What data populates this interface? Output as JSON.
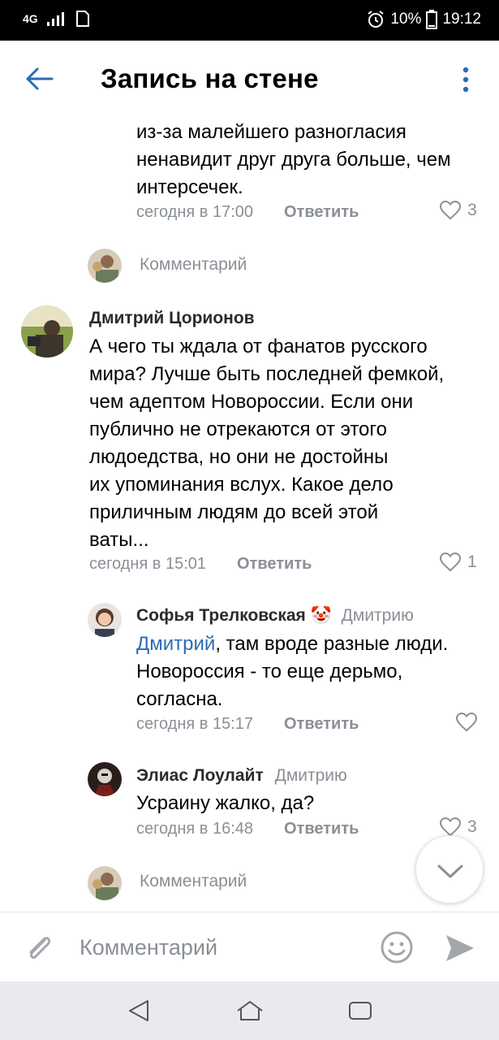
{
  "status_bar": {
    "network": "4G",
    "battery": "10%",
    "time": "19:12"
  },
  "header": {
    "title": "Запись на стене"
  },
  "comments": {
    "top_text_lines": [
      "из-за малейшего разногласия",
      "ненавидит друг друга больше, чем",
      "интерсечек."
    ],
    "top_time": "сегодня в 17:00",
    "top_reply": "Ответить",
    "top_likes": "3",
    "prompt1": "Комментарий",
    "c1_name": "Дмитрий Цорионов",
    "c1_lines": [
      "А чего ты ждала от фанатов русского",
      "мира? Лучше быть последней фемкой,",
      "чем адептом Новороссии. Если они",
      "публично не отрекаются от этого",
      "людоедства, но они не достойны",
      "их упоминания вслух. Какое дело",
      "приличным людям до всей этой",
      "ваты..."
    ],
    "c1_time": "сегодня в 15:01",
    "c1_reply": "Ответить",
    "c1_likes": "1",
    "c2_name": "Софья Трелковская",
    "c2_emoji": "🤡",
    "c2_to": "Дмитрию",
    "c2_mention": "Дмитрий",
    "c2_line1_rest": ", там вроде разные люди.",
    "c2_line2": "Новороссия - то еще дерьмо,",
    "c2_line3": "согласна.",
    "c2_time": "сегодня в 15:17",
    "c2_reply": "Ответить",
    "c3_name": "Элиас Лоулайт",
    "c3_to": "Дмитрию",
    "c3_text": "Усраину жалко, да?",
    "c3_time": "сегодня в 16:48",
    "c3_reply": "Ответить",
    "c3_likes": "3",
    "prompt2": "Комментарий"
  },
  "input": {
    "placeholder": "Комментарий"
  },
  "colors": {
    "accent": "#2b6bb5",
    "muted": "#8a8f96",
    "navbar": "#e9eaee"
  },
  "icons": [
    "back-arrow-icon",
    "more-vertical-icon",
    "heart-icon",
    "chevron-down-icon",
    "paperclip-icon",
    "emoji-icon",
    "send-icon",
    "nav-back-icon",
    "nav-home-icon",
    "nav-recents-icon"
  ]
}
